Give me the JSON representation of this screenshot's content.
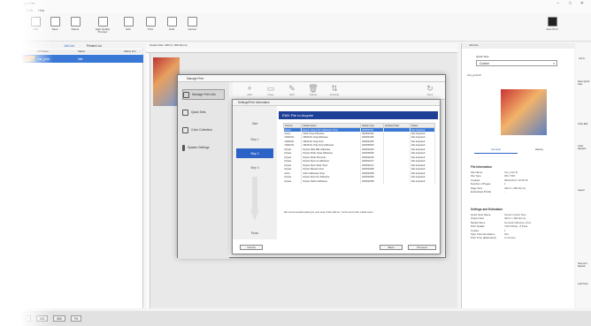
{
  "app": {
    "title": "Epson Edge Print",
    "menu": [
      "File",
      "Edit",
      "Tools",
      "Help"
    ]
  },
  "ribbon": [
    {
      "label": "Add",
      "icon": "add-icon"
    },
    {
      "label": "Save",
      "icon": "save-icon"
    },
    {
      "label": "Delete",
      "icon": "delete-icon"
    },
    {
      "label": "High Quality Preview",
      "icon": "preview-icon"
    },
    {
      "label": "Edit",
      "icon": "edit-icon"
    },
    {
      "label": "Print",
      "icon": "print-icon"
    },
    {
      "label": "Hold",
      "icon": "hold-icon"
    },
    {
      "label": "Cancel",
      "icon": "cancel-icon"
    }
  ],
  "ribbon_right": {
    "label": "Auto Print"
  },
  "left": {
    "tabs": [
      "Job List",
      "Printed List"
    ],
    "columns": [
      "Job Name",
      "Status",
      "Status Info"
    ],
    "row": {
      "name": "Car_print",
      "status": "Idle"
    }
  },
  "center": {
    "header": "Output Size: 400.0 x 300.0(mm)"
  },
  "right": {
    "header": "Job Info",
    "quick_label": "Quick Sets",
    "quick_value": "Custom",
    "job_name": "Car_print.tif",
    "tabs": [
      "General",
      "History"
    ],
    "file_title": "File Information",
    "file_rows": [
      [
        "File Name",
        "Car_print.tif"
      ],
      [
        "File Type",
        "IMG.TIFF"
      ],
      [
        "Created",
        "06/01/2017 10:06:25"
      ],
      [
        "Number of Pages",
        "1"
      ],
      [
        "Page Size",
        "400.0 x 300.0(mm)"
      ],
      [
        "Embedded Profile",
        "-"
      ]
    ],
    "settings_title": "Settings and Estimation",
    "settings_rows": [
      [
        "Quick Sets Name",
        "System Quick Sets"
      ],
      [
        "Output Size",
        "400.0 x 300.0(mm)"
      ],
      [
        "Media Name",
        "General Adhesive Vinyl"
      ],
      [
        "Print Quality",
        "720x720dpi - 8 Pass"
      ],
      [
        "Copies",
        "1"
      ],
      [
        "Spot Color Emulation",
        "N/A"
      ],
      [
        "Print Time (Estimated)",
        "2 minutes"
      ]
    ]
  },
  "far": [
    "Job S..",
    "Save Quick Sets",
    "Color Edit",
    "Color Replace",
    "Layout",
    "Step and Repeat",
    "Last Pane"
  ],
  "status": [
    "100%",
    "300",
    "500",
    "Fit"
  ],
  "dlg1": {
    "title": "Manage Print",
    "items": [
      "Manage Print Info",
      "Quick Sets",
      "Color Collection",
      "System Settings"
    ],
    "toolbar": [
      "Add",
      "Copy",
      "Edit",
      "Delete",
      "Activate",
      "Sync"
    ]
  },
  "dlg2": {
    "title": "Settings/Print Information",
    "steps": [
      "Start",
      "Step 1",
      "Step 2",
      "Step 3",
      "Finish"
    ],
    "heading": "EMX File to Acquire",
    "columns": [
      "Version",
      "Media Name",
      "Media Type",
      "Updated Date",
      "Status"
    ],
    "rows": [
      [
        "Epson",
        "Epson Gloss Film Adhesive Vinyl",
        "2018/07/01",
        "",
        "Not Acquired"
      ],
      [
        "Avery",
        "3100 Vinyl Adhesive",
        "2018/01/02",
        "",
        "Not Acquired"
      ],
      [
        "ORAFOL",
        "ORAFOL Oraj Adhesive",
        "2018/01/06",
        "",
        "Not Acquired"
      ],
      [
        "ORAFOL",
        "ORAFOL Oraj Vinyl",
        "2018/01/05",
        "",
        "Not Acquired"
      ],
      [
        "ORAFOL",
        "ORAFOL Oraj Vinyl Adhesive",
        "2018/05/25",
        "",
        "Not Acquired"
      ],
      [
        "Drytac",
        "Drytac Stile FBL Adhesive",
        "2018/03/25",
        "",
        "Not Acquired"
      ],
      [
        "Drytac",
        "Drytac Polar Clear Adhesive",
        "2018/05/25",
        "",
        "Not Acquired"
      ],
      [
        "Drytac",
        "Drytac Polar Premium",
        "2018/02/25",
        "",
        "Not Acquired"
      ],
      [
        "Drytac",
        "Drytac Spot-on Adhesive",
        "2018/02/17",
        "",
        "Not Acquired"
      ],
      [
        "Drytac",
        "Drytac Spot Clear Vinyl",
        "2018/02/17",
        "",
        "Not Acquired"
      ],
      [
        "Drytac",
        "Drytac Reveal Vinyl",
        "2018/02/08",
        "",
        "Not Acquired"
      ],
      [
        "Arlon",
        "Arlon Adhesive Vinyl",
        "2018/02/08",
        "",
        "Not Acquired"
      ],
      [
        "Drytac",
        "Drytac Spot-On Adhesive",
        "2018/02/08",
        "",
        "Not Acquired"
      ],
      [
        "Drytac",
        "Drytac Fabric Adhesive",
        "2018/02/08",
        "",
        "Not Acquired"
      ]
    ],
    "note": "We recommended setting for your area. Files with an * at the end of the media name.",
    "buttons": {
      "cancel": "Cancel",
      "back": "Back",
      "proceed": "Proceed"
    }
  }
}
